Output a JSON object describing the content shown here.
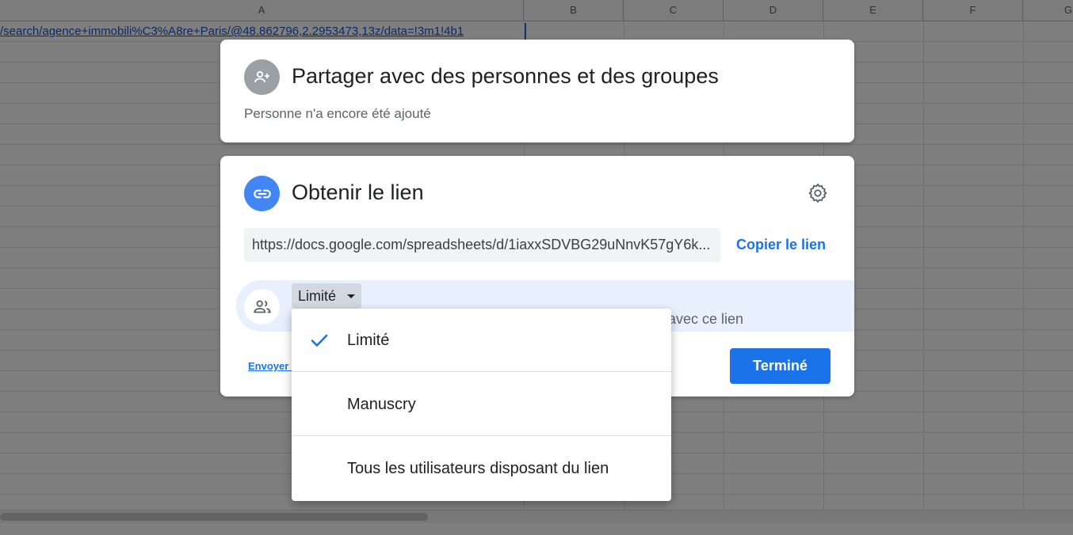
{
  "spreadsheet": {
    "columns": [
      "A",
      "B",
      "C",
      "D",
      "E",
      "F",
      "G"
    ],
    "cell_a1_text": "/search/agence+immobili%C3%A8re+Paris/@48.862796,2.2953473,13z/data=!3m1!4b1"
  },
  "share_card": {
    "title": "Partager avec des personnes et des groupes",
    "subtitle": "Personne n'a encore été ajouté",
    "avatar_icon": "person-add-icon"
  },
  "link_card": {
    "title": "Obtenir le lien",
    "link_icon": "link-icon",
    "settings_icon": "gear-icon",
    "url": "https://docs.google.com/spreadsheets/d/1iaxxSDVBG29uNnvK57gY6k...",
    "copy_label": "Copier le lien",
    "access_selected": "Limité",
    "access_description": "avec ce lien",
    "send_link": "Envoyer c",
    "done_label": "Terminé"
  },
  "dropdown": {
    "options": [
      {
        "label": "Limité",
        "selected": true
      },
      {
        "label": "Manuscry",
        "selected": false
      },
      {
        "label": "Tous les utilisateurs disposant du lien",
        "selected": false
      }
    ]
  },
  "colors": {
    "accent": "#1a73e8",
    "avatar_gray": "#9aa0a6",
    "link_blue": "#4285f4",
    "access_row_bg": "#e8f0fe"
  }
}
